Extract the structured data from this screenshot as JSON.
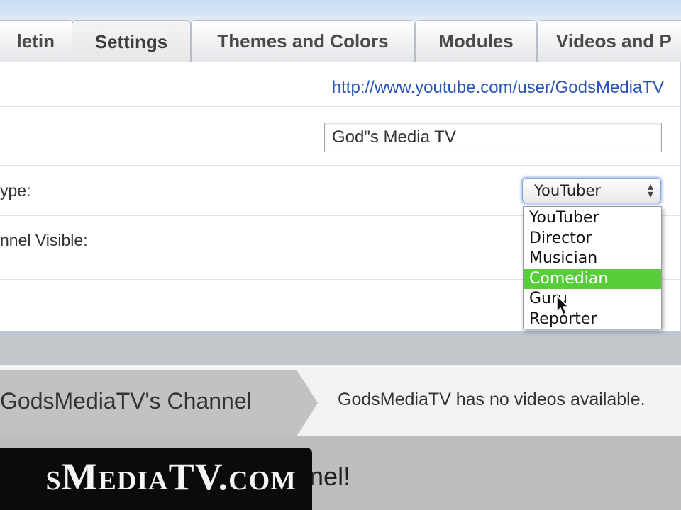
{
  "tabs": [
    {
      "label": "Bulletin",
      "visible": "letin"
    },
    {
      "label": "Settings",
      "visible": "Settings",
      "active": true
    },
    {
      "label": "Themes and Colors",
      "visible": "Themes and Colors"
    },
    {
      "label": "Modules",
      "visible": "Modules"
    },
    {
      "label": "Videos and P",
      "visible": "Videos and P"
    }
  ],
  "settings": {
    "channel_url": "http://www.youtube.com/user/GodsMediaTV",
    "title_value": "God\"s Media TV",
    "type_label": "ype:",
    "visible_label": "nnel Visible:",
    "channel_type": {
      "selected": "YouTuber",
      "options": [
        "YouTuber",
        "Director",
        "Musician",
        "Comedian",
        "Guru",
        "Reporter"
      ],
      "highlighted": "Comedian"
    }
  },
  "channel": {
    "title": "GodsMediaTV's Channel",
    "no_videos": "GodsMediaTV has no videos available.",
    "lower_text": "nnel!"
  },
  "watermark": {
    "text": "sMediaTV.com"
  },
  "colors": {
    "highlight": "#58cd3a",
    "link": "#2a55b4"
  }
}
